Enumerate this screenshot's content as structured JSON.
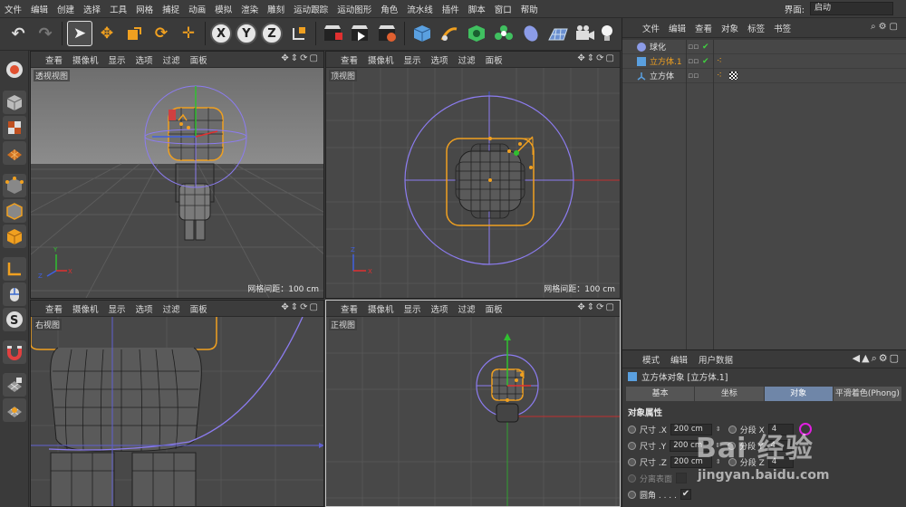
{
  "menu": [
    "文件",
    "编辑",
    "创建",
    "选择",
    "工具",
    "网格",
    "捕捉",
    "动画",
    "模拟",
    "渲染",
    "雕刻",
    "运动跟踪",
    "运动图形",
    "角色",
    "流水线",
    "插件",
    "脚本",
    "窗口",
    "帮助"
  ],
  "layout": {
    "label": "界面:",
    "value": "启动"
  },
  "toolbar": {
    "axis_x": "X",
    "axis_y": "Y",
    "axis_z": "Z"
  },
  "viewport_menu": [
    "查看",
    "摄像机",
    "显示",
    "选项",
    "过滤",
    "面板"
  ],
  "viewports": {
    "perspective": {
      "name": "透视视图",
      "grid": "网格间距：100 cm"
    },
    "top": {
      "name": "顶视图",
      "grid": "网格间距：100 cm"
    },
    "right": {
      "name": "右视图"
    },
    "front": {
      "name": "正视图"
    }
  },
  "object_manager": {
    "menu": [
      "文件",
      "编辑",
      "查看",
      "对象",
      "标签",
      "书签"
    ],
    "objects": [
      {
        "name": "球化",
        "selected": false
      },
      {
        "name": "立方体.1",
        "selected": true
      },
      {
        "name": "立方体",
        "selected": false
      }
    ]
  },
  "attributes": {
    "menu": [
      "模式",
      "编辑",
      "用户数据"
    ],
    "title": "立方体对象 [立方体.1]",
    "tabs": [
      "基本",
      "坐标",
      "对象",
      "平滑着色(Phong)"
    ],
    "active_tab": "对象",
    "section": "对象属性",
    "rows": [
      {
        "label": "尺寸 .X",
        "value": "200 cm",
        "seg_label": "分段 X",
        "seg_value": "4"
      },
      {
        "label": "尺寸 .Y",
        "value": "200 cm",
        "seg_label": "分段 Y",
        "seg_value": "4"
      },
      {
        "label": "尺寸 .Z",
        "value": "200 cm",
        "seg_label": "分段 Z",
        "seg_value": "4"
      }
    ],
    "separate_label": "分离表面",
    "fillet_label": "圆角 . . . .",
    "fillet_checked": "✔"
  },
  "watermark": {
    "text": "Bai 经验",
    "url": "jingyan.baidu.com"
  },
  "colors": {
    "accent": "#f0a020",
    "deformer": "#8c7cf0",
    "axis_x": "#e03030",
    "axis_y": "#30c030",
    "axis_z": "#4060e0"
  }
}
